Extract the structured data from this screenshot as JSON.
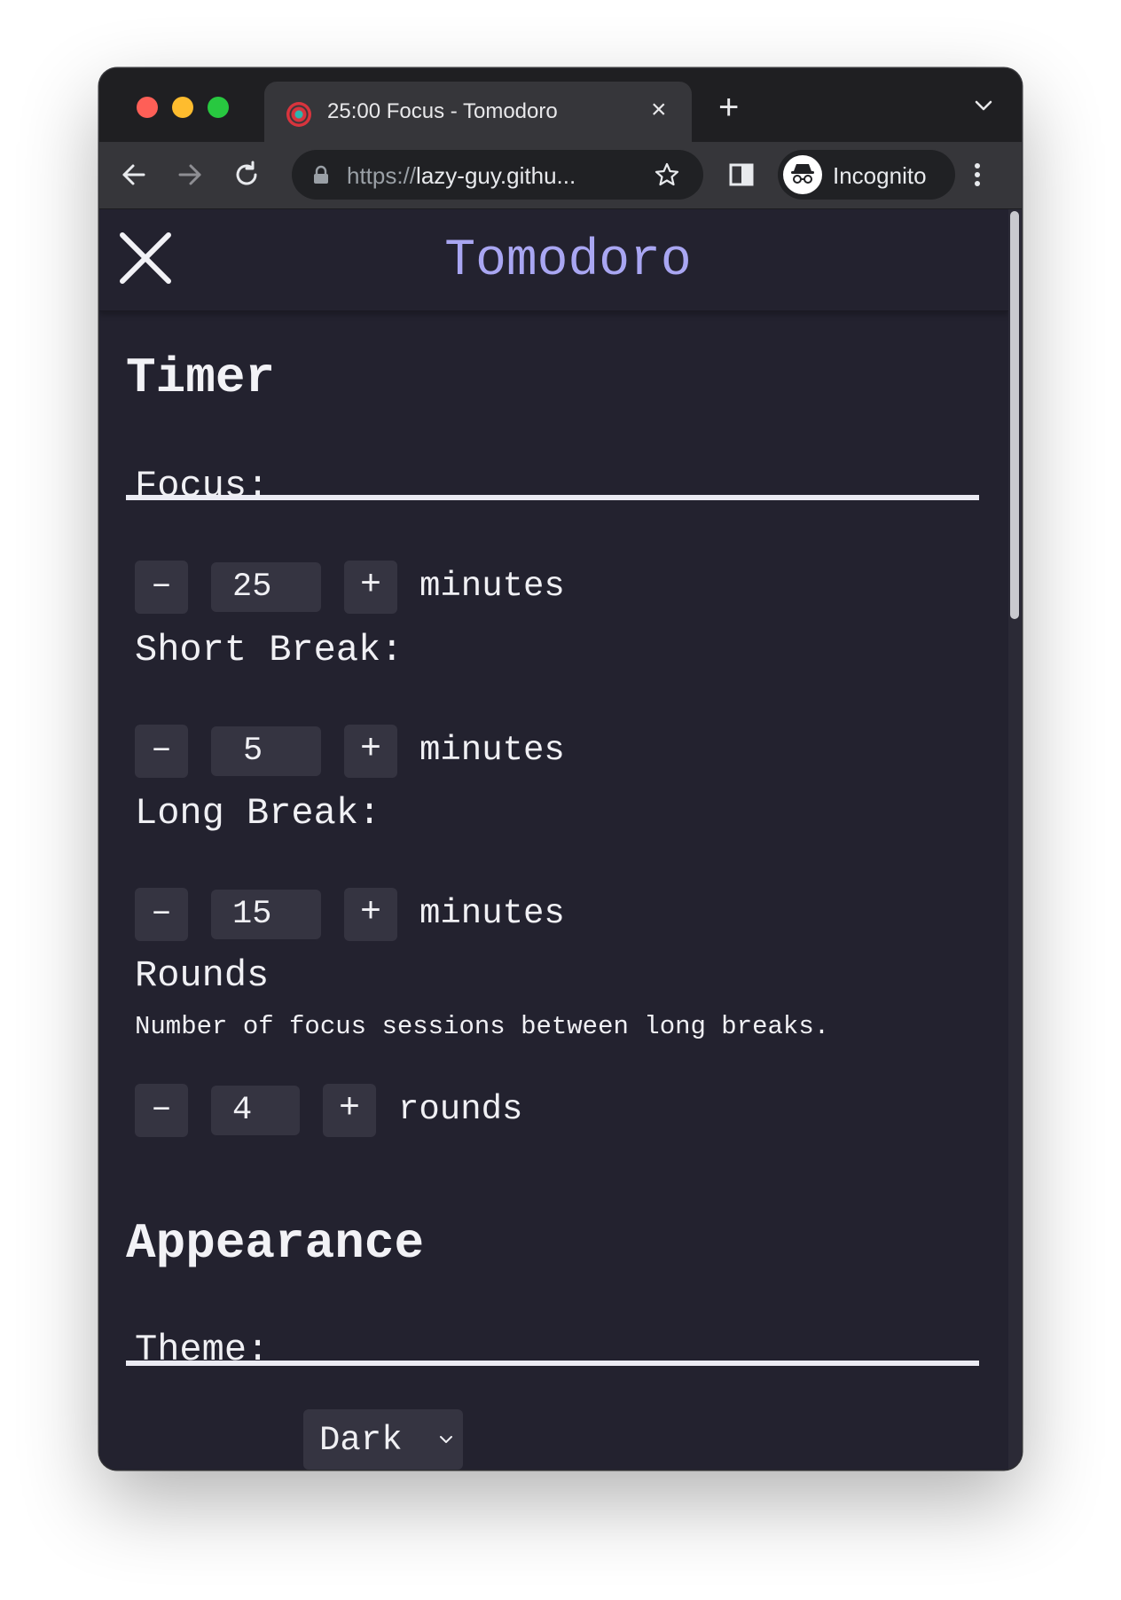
{
  "browser": {
    "tab": {
      "title": "25:00 Focus - Tomodoro",
      "close_icon": "×",
      "favicon": "tomato-target-icon"
    },
    "new_tab_label": "+",
    "url": {
      "scheme": "https://",
      "host": "lazy-guy.githu..."
    },
    "incognito_label": "Incognito"
  },
  "app": {
    "title": "Tomodoro",
    "title_color": "#a9a6f2",
    "background": "#23222f"
  },
  "timer": {
    "heading": "Timer",
    "fields": [
      {
        "label": "Focus:",
        "value": "25",
        "unit": "minutes"
      },
      {
        "label": "Short Break:",
        "value": "5",
        "unit": "minutes"
      },
      {
        "label": "Long Break:",
        "value": "15",
        "unit": "minutes"
      }
    ],
    "rounds": {
      "label": "Rounds",
      "description": "Number of focus sessions between long breaks.",
      "value": "4",
      "unit": "rounds"
    },
    "decrement_label": "–",
    "increment_label": "+"
  },
  "appearance": {
    "heading": "Appearance",
    "theme_label": "Theme:",
    "theme_value": "Dark"
  }
}
